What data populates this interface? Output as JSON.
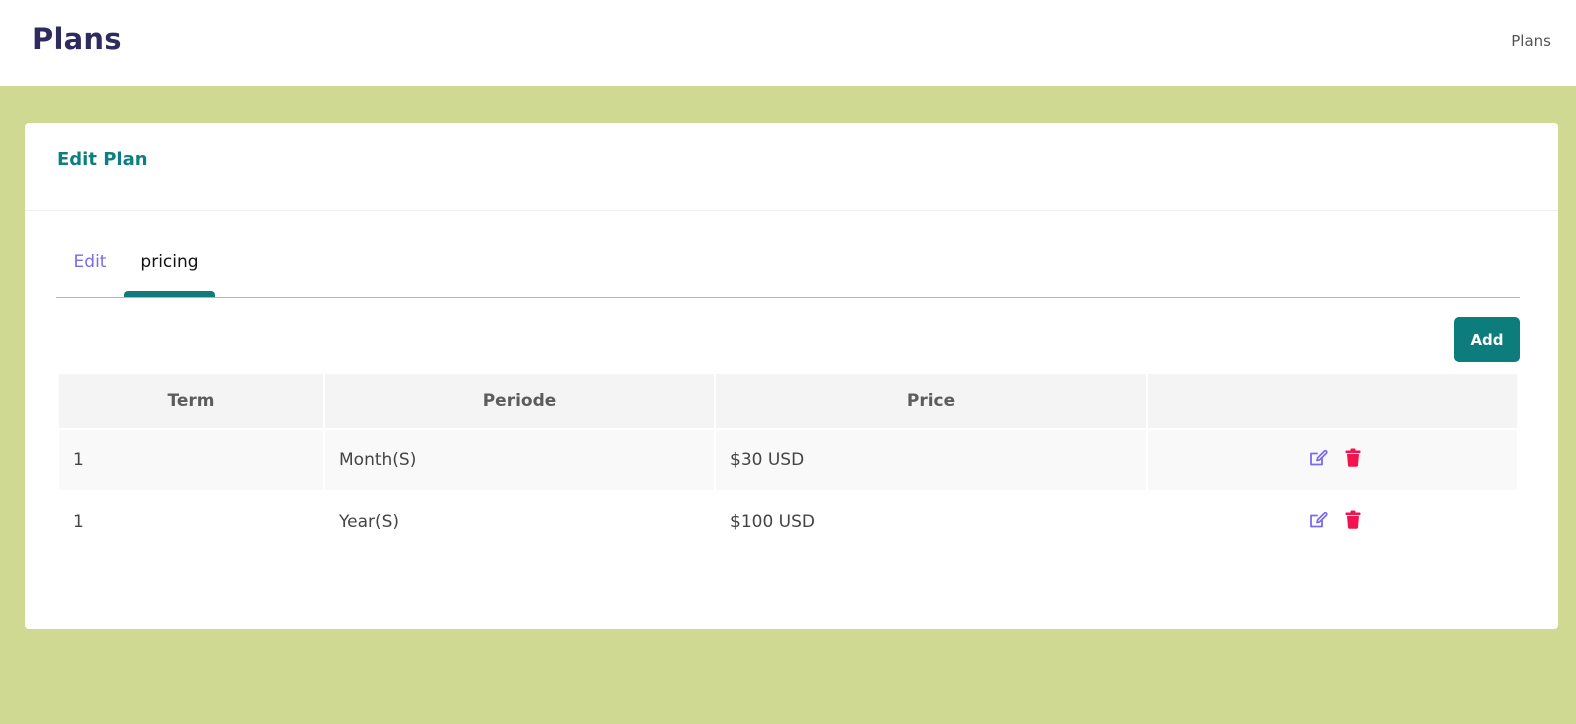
{
  "header": {
    "title": "Plans",
    "breadcrumb": "Plans"
  },
  "card": {
    "title": "Edit Plan"
  },
  "tabs": [
    {
      "label": "Edit",
      "active": false
    },
    {
      "label": "pricing",
      "active": true
    }
  ],
  "toolbar": {
    "add_label": "Add"
  },
  "table": {
    "columns": [
      "Term",
      "Periode",
      "Price",
      ""
    ],
    "rows": [
      {
        "term": "1",
        "periode": "Month(S)",
        "price": "$30 USD"
      },
      {
        "term": "1",
        "periode": "Year(S)",
        "price": "$100 USD"
      }
    ],
    "row_actions": [
      "edit-icon",
      "trash-icon"
    ]
  },
  "colors": {
    "background": "#cfd992",
    "accent": "#0d7c7c",
    "title": "#2e2c5e",
    "link": "#7a6be8",
    "danger": "#f0134d"
  }
}
